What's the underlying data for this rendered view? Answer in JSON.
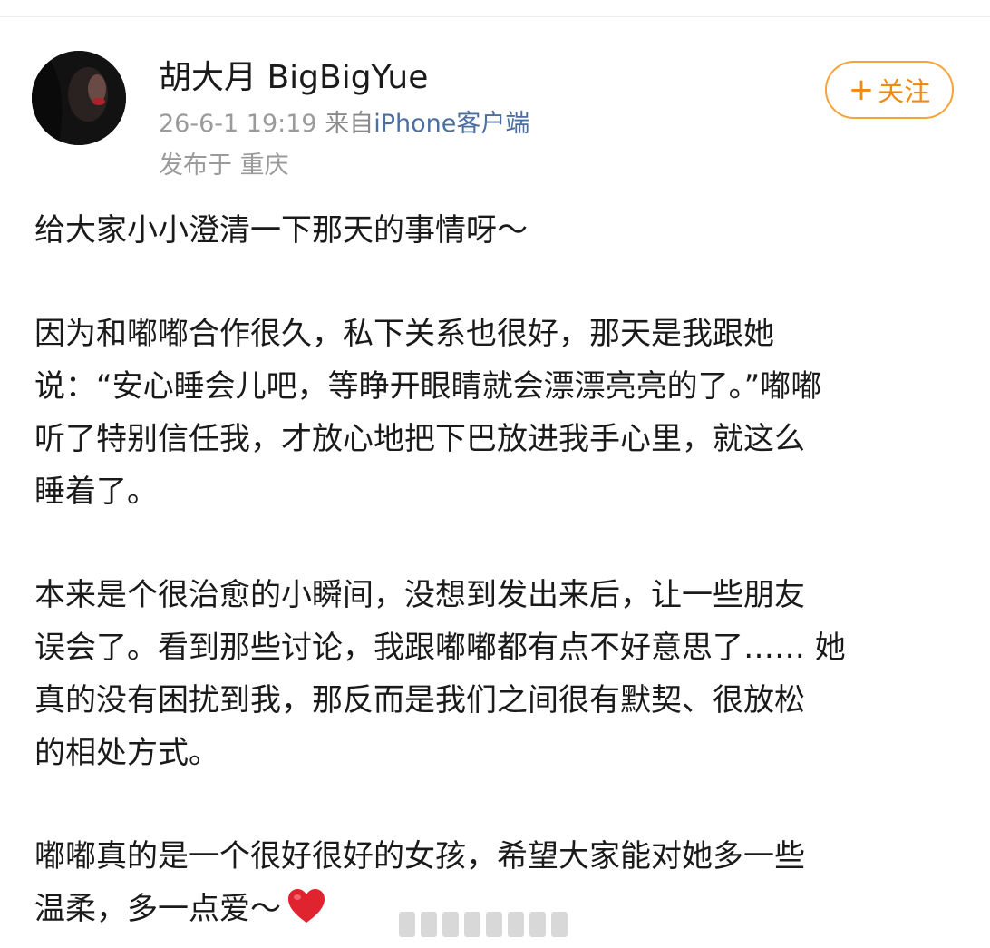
{
  "user": {
    "name": "胡大月 BigBigYue",
    "date": "26-6-1 19:19",
    "source_prefix": "来自",
    "client": "iPhone客户端",
    "location": "发布于 重庆"
  },
  "follow_button": {
    "plus": "+",
    "label": "关注"
  },
  "post": {
    "paragraphs": [
      "给大家小小澄清一下那天的事情呀～",
      "因为和嘟嘟合作很久，私下关系也很好，那天是我跟她\n说：“安心睡会儿吧，等睁开眼睛就会漂漂亮亮的了。”嘟嘟\n听了特别信任我，才放心地把下巴放进我手心里，就这么\n睡着了。",
      "本来是个很治愈的小瞬间，没想到发出来后，让一些朋友\n误会了。看到那些讨论，我跟嘟嘟都有点不好意思了…… 她\n真的没有困扰到我，那反而是我们之间很有默契、很放松\n的相处方式。",
      "嘟嘟真的是一个很好很好的女孩，希望大家能对她多一些\n温柔，多一点爱～"
    ]
  },
  "icons": {
    "avatar": "user-avatar",
    "heart": "red-heart-icon"
  },
  "colors": {
    "follow_accent": "#f08a10",
    "client_link": "#4c6fa0",
    "heart": "#e0242f"
  }
}
